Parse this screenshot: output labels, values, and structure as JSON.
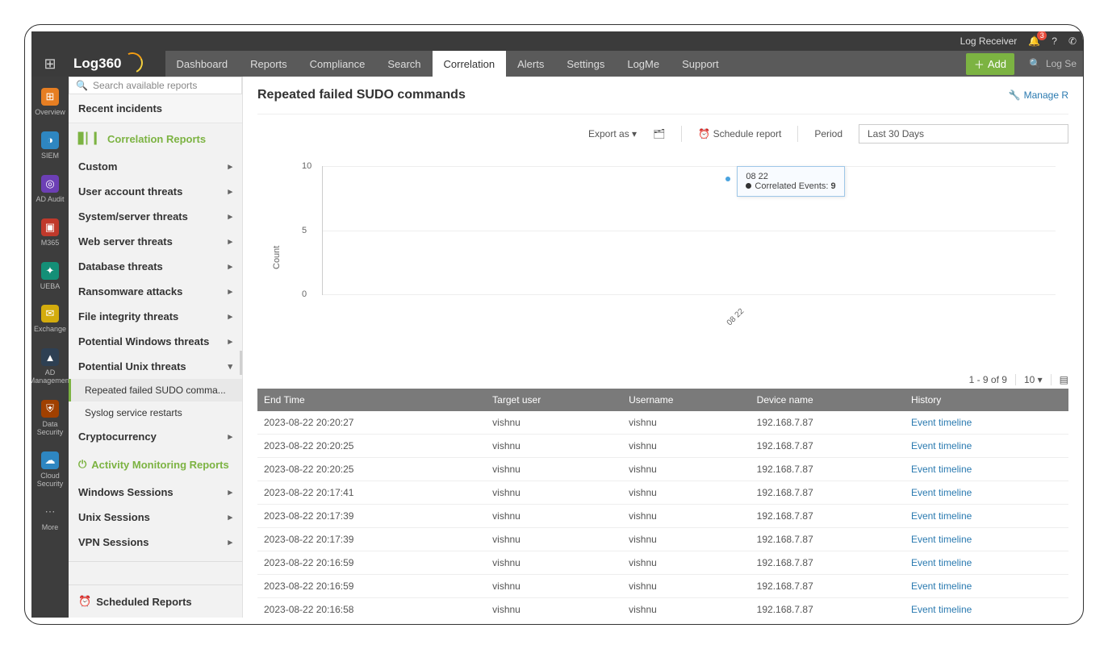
{
  "toputil": {
    "logreceiver": "Log Receiver",
    "notif_count": "3",
    "help": "?",
    "search_placeholder": "Log Se"
  },
  "brand": "Log360",
  "nav": {
    "items": [
      "Dashboard",
      "Reports",
      "Compliance",
      "Search",
      "Correlation",
      "Alerts",
      "Settings",
      "LogMe",
      "Support"
    ],
    "active": 4,
    "add": "Add"
  },
  "strip": [
    {
      "label": "Overview",
      "clr": "orange",
      "g": "⊞"
    },
    {
      "label": "SIEM",
      "clr": "blue",
      "g": "◑"
    },
    {
      "label": "AD Audit",
      "clr": "purple",
      "g": "◎"
    },
    {
      "label": "M365",
      "clr": "red",
      "g": "▣"
    },
    {
      "label": "UEBA",
      "clr": "green",
      "g": "✦"
    },
    {
      "label": "Exchange",
      "clr": "yellow",
      "g": "✉"
    },
    {
      "label": "AD Management",
      "clr": "navy",
      "g": "▲"
    },
    {
      "label": "Data Security",
      "clr": "brown",
      "g": "⛨"
    },
    {
      "label": "Cloud Security",
      "clr": "sky",
      "g": "☁"
    },
    {
      "label": "More",
      "clr": "",
      "g": "⋯"
    }
  ],
  "sidebar": {
    "search_placeholder": "Search available reports",
    "recent": "Recent incidents",
    "cor_head": "Correlation Reports",
    "menus": [
      "Custom",
      "User account threats",
      "System/server threats",
      "Web server threats",
      "Database threats",
      "Ransomware attacks",
      "File integrity threats",
      "Potential Windows threats",
      "Potential Unix threats"
    ],
    "expanded_idx": 8,
    "subitems": [
      {
        "label": "Repeated failed SUDO comma...",
        "active": true
      },
      {
        "label": "Syslog service restarts",
        "active": false
      }
    ],
    "after_menus": [
      "Cryptocurrency"
    ],
    "act_head": "Activity Monitoring Reports",
    "act_menus": [
      "Windows Sessions",
      "Unix Sessions",
      "VPN Sessions"
    ],
    "scheduled": "Scheduled Reports"
  },
  "page": {
    "title": "Repeated failed SUDO commands",
    "manage": "Manage R",
    "export": "Export as",
    "schedule": "Schedule report",
    "period": "Period",
    "period_value": "Last 30 Days"
  },
  "chart_data": {
    "type": "scatter",
    "ylabel": "Count",
    "yticks": [
      0,
      5,
      10
    ],
    "ylim": [
      0,
      10
    ],
    "x": [
      "08 22"
    ],
    "series": [
      {
        "name": "Correlated Events",
        "values": [
          9
        ]
      }
    ],
    "tooltip": {
      "date": "08 22",
      "label": "Correlated Events:",
      "value": "9"
    }
  },
  "table": {
    "pager": "1 - 9 of 9",
    "page_size": "10",
    "headers": [
      "End Time",
      "Target user",
      "Username",
      "Device name",
      "History"
    ],
    "history_link": "Event timeline",
    "rows": [
      [
        "2023-08-22 20:20:27",
        "vishnu",
        "vishnu",
        "192.168.7.87"
      ],
      [
        "2023-08-22 20:20:25",
        "vishnu",
        "vishnu",
        "192.168.7.87"
      ],
      [
        "2023-08-22 20:20:25",
        "vishnu",
        "vishnu",
        "192.168.7.87"
      ],
      [
        "2023-08-22 20:17:41",
        "vishnu",
        "vishnu",
        "192.168.7.87"
      ],
      [
        "2023-08-22 20:17:39",
        "vishnu",
        "vishnu",
        "192.168.7.87"
      ],
      [
        "2023-08-22 20:17:39",
        "vishnu",
        "vishnu",
        "192.168.7.87"
      ],
      [
        "2023-08-22 20:16:59",
        "vishnu",
        "vishnu",
        "192.168.7.87"
      ],
      [
        "2023-08-22 20:16:59",
        "vishnu",
        "vishnu",
        "192.168.7.87"
      ],
      [
        "2023-08-22 20:16:58",
        "vishnu",
        "vishnu",
        "192.168.7.87"
      ]
    ]
  }
}
